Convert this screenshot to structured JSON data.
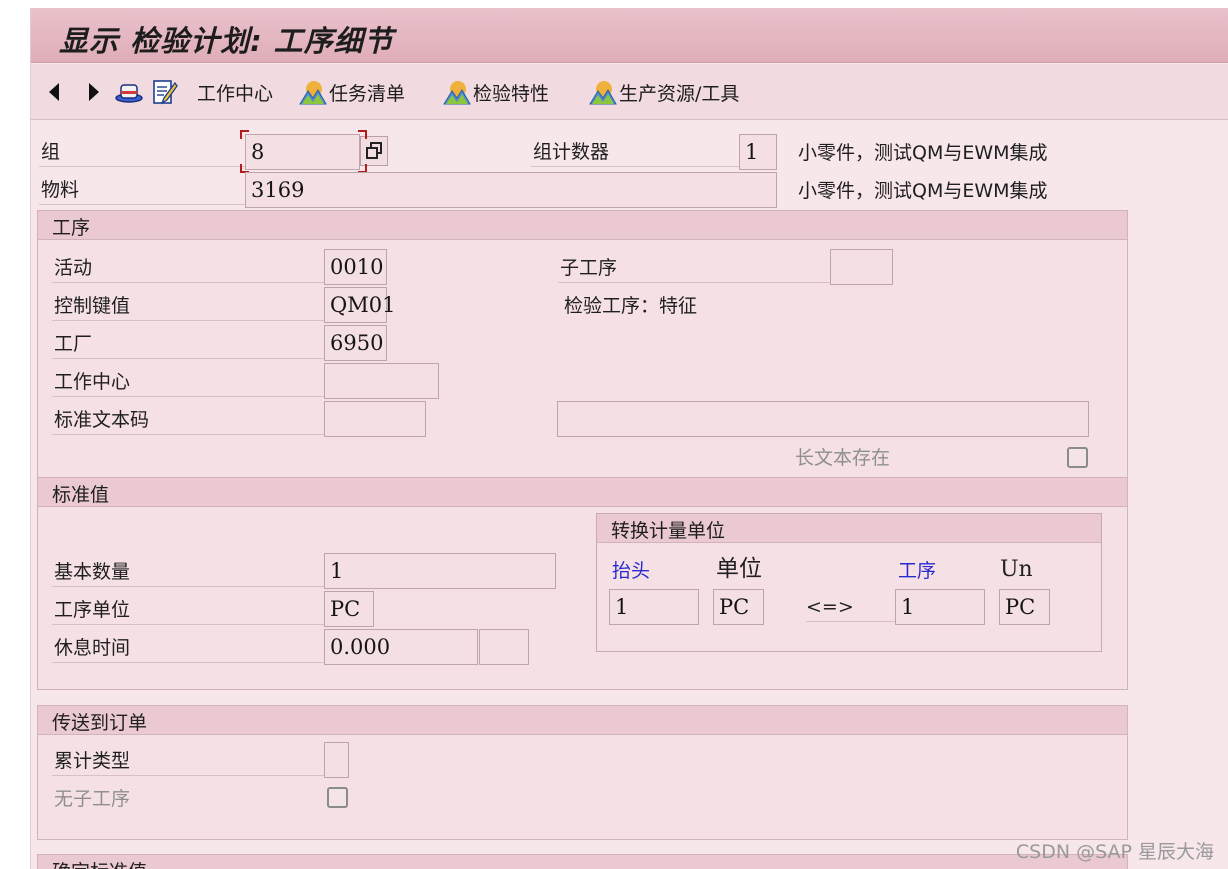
{
  "window": {
    "title": "显示 检验计划: 工序细节"
  },
  "toolbar": {
    "work_center": "工作中心",
    "task_list": "任务清单",
    "insp_char": "检验特性",
    "prt": "生产资源/工具"
  },
  "header": {
    "group_label": "组",
    "group_value": "8",
    "counter_label": "组计数器",
    "counter_value": "1",
    "group_desc": "小零件，测试QM与EWM集成",
    "material_label": "物料",
    "material_value": "3169",
    "material_desc": "小零件，测试QM与EWM集成"
  },
  "operation": {
    "title": "工序",
    "activity_label": "活动",
    "activity_value": "0010",
    "sub_op_label": "子工序",
    "sub_op_value": "",
    "control_key_label": "控制键值",
    "control_key_value": "QM01",
    "control_key_desc": "检验工序：特征",
    "plant_label": "工厂",
    "plant_value": "6950",
    "work_center_label": "工作中心",
    "work_center_value": "",
    "std_text_label": "标准文本码",
    "std_text_value": "",
    "std_text_desc": "",
    "long_text_label": "长文本存在"
  },
  "standard_values": {
    "title": "标准值",
    "base_qty_label": "基本数量",
    "base_qty_value": "1",
    "op_unit_label": "工序单位",
    "op_unit_value": "PC",
    "break_label": "休息时间",
    "break_value": "0.000",
    "break_unit": "",
    "conversion": {
      "title": "转换计量单位",
      "header_label": "抬头",
      "unit_label": "单位",
      "op_label": "工序",
      "un_label": "Un",
      "header_qty": "1",
      "header_unit": "PC",
      "arrow": "<=>",
      "op_qty": "1",
      "op_unit": "PC"
    }
  },
  "transfer": {
    "title": "传送到订单",
    "cum_type_label": "累计类型",
    "cum_type_value": "",
    "no_subop_label": "无子工序"
  },
  "next_section": {
    "title": "确定标准值"
  },
  "watermark": "CSDN @SAP 星辰大海",
  "colors": {
    "title_bg": "#e3b6c0",
    "panel_bg": "#f7e6ea",
    "group_head": "#ebc9d1",
    "link_blue": "#2a2ad0"
  }
}
